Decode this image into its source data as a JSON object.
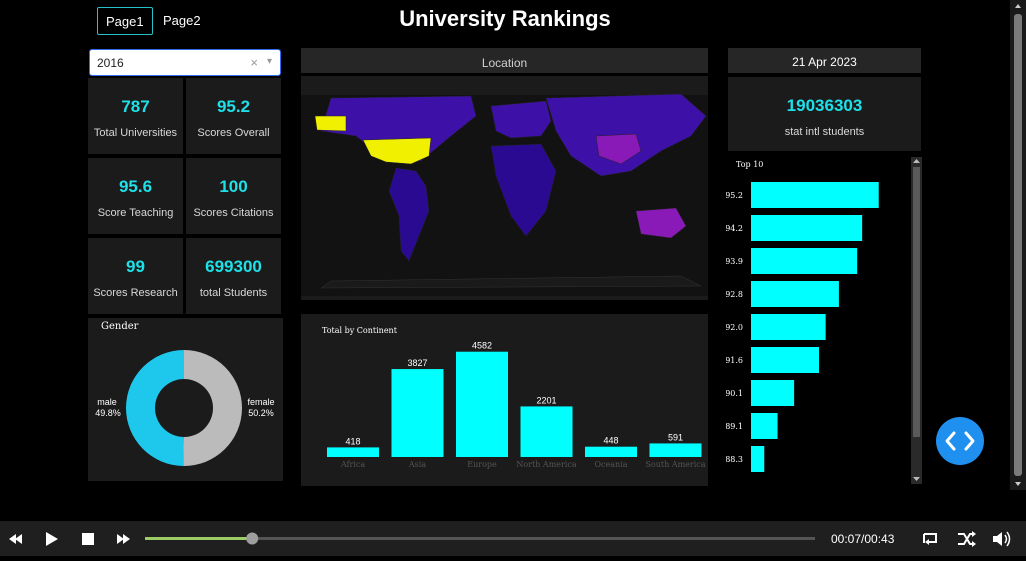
{
  "tabs": [
    {
      "label": "Page1",
      "active": true
    },
    {
      "label": "Page2",
      "active": false
    }
  ],
  "title": "University Rankings",
  "year_select": {
    "value": "2016",
    "clear": "×",
    "caret": "▾"
  },
  "kpis": [
    {
      "value": "787",
      "label": "Total Universities"
    },
    {
      "value": "95.2",
      "label": "Scores Overall"
    },
    {
      "value": "95.6",
      "label": "Score Teaching"
    },
    {
      "value": "100",
      "label": "Scores Citations"
    },
    {
      "value": "99",
      "label": "Scores Research"
    },
    {
      "value": "699300",
      "label": "total Students"
    }
  ],
  "gender": {
    "title": "Gender",
    "male_label": "male",
    "male_pct": "49.8%",
    "male_value": 49.8,
    "female_label": "female",
    "female_pct": "50.2%",
    "female_value": 50.2,
    "male_color": "#1ec8ec",
    "female_color": "#bbbbbb"
  },
  "map": {
    "title": "Location"
  },
  "date": "21 Apr 2023",
  "intl": {
    "value": "19036303",
    "label": "stat intl students"
  },
  "chart_data": [
    {
      "type": "bar",
      "title": "Total by Continent",
      "categories": [
        "Africa",
        "Asia",
        "Europe",
        "North America",
        "Oceania",
        "South America"
      ],
      "values": [
        418,
        3827,
        4582,
        2201,
        448,
        591
      ],
      "labels": [
        "418",
        "3827",
        "4582",
        "2201",
        "448",
        "591"
      ],
      "ylim": [
        0,
        4700
      ],
      "color": "#00ffff"
    },
    {
      "type": "bar",
      "orientation": "horizontal",
      "title": "Top 10",
      "categories": [
        "95.2",
        "94.2",
        "93.9",
        "92.8",
        "92.0",
        "91.6",
        "90.1",
        "89.1",
        "88.3"
      ],
      "values": [
        95.2,
        94.2,
        93.9,
        92.8,
        92.0,
        91.6,
        90.1,
        89.1,
        88.3
      ],
      "xlim": [
        87.5,
        96
      ],
      "color": "#00ffff"
    }
  ],
  "player": {
    "time": "00:07/00:43",
    "progress": 0.16
  }
}
